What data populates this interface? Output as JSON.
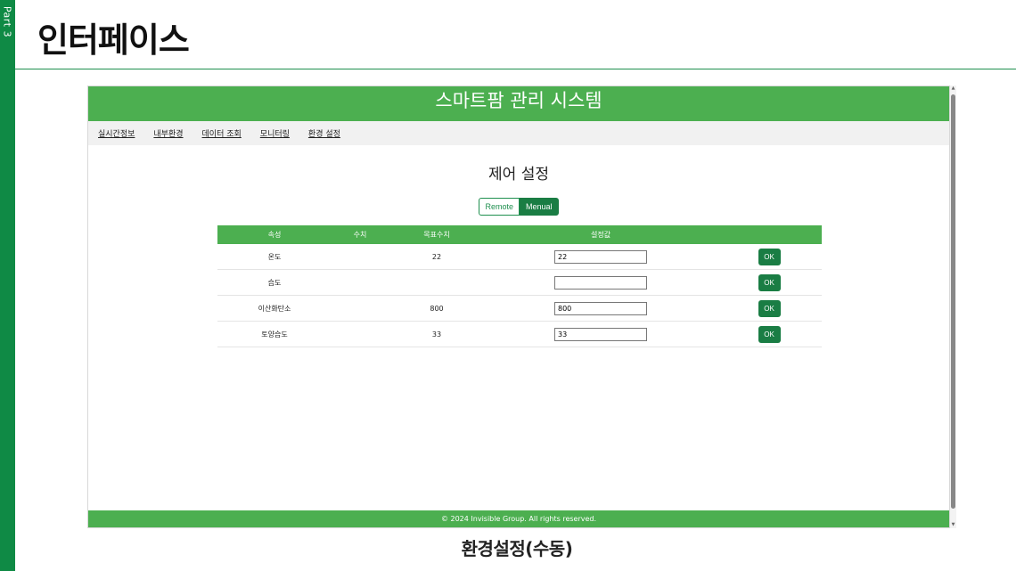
{
  "slide": {
    "side_label": "Part 3",
    "title": "인터페이스",
    "caption": "환경설정(수동)"
  },
  "app": {
    "header_title": "스마트팜 관리 시스템",
    "nav": [
      "실시간정보",
      "내부환경",
      "데이터 조회",
      "모니터링",
      "환경 설정"
    ],
    "panel_title": "제어 설정",
    "mode": {
      "remote_label": "Remote",
      "manual_label": "Menual",
      "active": "Menual"
    },
    "table": {
      "headers": [
        "속성",
        "수치",
        "목표수치",
        "설정값",
        ""
      ],
      "rows": [
        {
          "attr": "온도",
          "value": "",
          "target": "22",
          "input": "22",
          "ok": "OK"
        },
        {
          "attr": "습도",
          "value": "",
          "target": "",
          "input": "",
          "ok": "OK"
        },
        {
          "attr": "이산화탄소",
          "value": "",
          "target": "800",
          "input": "800",
          "ok": "OK"
        },
        {
          "attr": "토양습도",
          "value": "",
          "target": "33",
          "input": "33",
          "ok": "OK"
        }
      ]
    },
    "footer": "© 2024 Invisible Group. All rights reserved.",
    "colors": {
      "header_green": "#4caf50",
      "button_green": "#1a7d44",
      "accent": "#0f8a45"
    }
  }
}
